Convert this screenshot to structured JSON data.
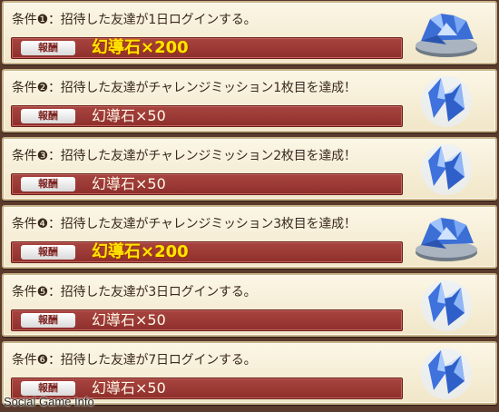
{
  "conditions": [
    {
      "label": "条件❶：招待した友達が1日ログインする。",
      "reward_tag": "報酬",
      "reward": "幻導石×200",
      "highlight": true,
      "icon": "crystal-bowl-icon"
    },
    {
      "label": "条件❷：招待した友達がチャレンジミッション1枚目を達成！",
      "reward_tag": "報酬",
      "reward": "幻導石×50",
      "highlight": false,
      "icon": "crystal-shards-icon"
    },
    {
      "label": "条件❸：招待した友達がチャレンジミッション2枚目を達成！",
      "reward_tag": "報酬",
      "reward": "幻導石×50",
      "highlight": false,
      "icon": "crystal-shards-icon"
    },
    {
      "label": "条件❹：招待した友達がチャレンジミッション3枚目を達成！",
      "reward_tag": "報酬",
      "reward": "幻導石×200",
      "highlight": true,
      "icon": "crystal-bowl-icon"
    },
    {
      "label": "条件❺：招待した友達が3日ログインする。",
      "reward_tag": "報酬",
      "reward": "幻導石×50",
      "highlight": false,
      "icon": "crystal-shards-icon"
    },
    {
      "label": "条件❻：招待した友達が7日ログインする。",
      "reward_tag": "報酬",
      "reward": "幻導石×50",
      "highlight": false,
      "icon": "crystal-shards-icon"
    }
  ],
  "watermark": "Social Game Info",
  "colors": {
    "reward_bar": "#9a3833",
    "highlight_text": "#ffe600",
    "crystal": "#4a7fe0"
  }
}
